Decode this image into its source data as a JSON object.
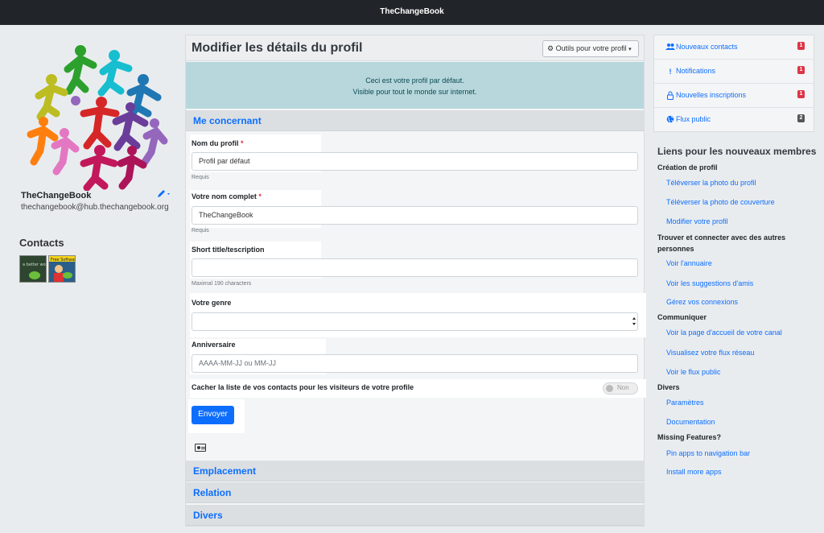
{
  "topbar": {
    "brand": "TheChangeBook"
  },
  "profile": {
    "name": "TheChangeBook",
    "address": "thechangebook@hub.thechangebook.org"
  },
  "contacts": {
    "title": "Contacts"
  },
  "panel": {
    "title": "Modifier les détails du profil",
    "tools_label": "Outils pour votre profil",
    "info_line1": "Ceci est votre profil par défaut.",
    "info_line2": "Visible pour tout le monde sur internet.",
    "section_about": "Me concernant",
    "fields": {
      "profile_name_label": "Nom du profil",
      "profile_name_value": "Profil par défaut",
      "profile_name_help": "Requis",
      "full_name_label": "Votre nom complet",
      "full_name_value": "TheChangeBook",
      "full_name_help": "Requis",
      "short_title_label": "Short title/tescription",
      "short_title_help": "Maximal 190 characters",
      "gender_label": "Votre genre",
      "birthday_label": "Anniversaire",
      "birthday_placeholder": "AAAA-MM-JJ ou MM-JJ",
      "hide_contacts_label": "Cacher la liste de vos contacts pour les visiteurs de votre profile",
      "hide_contacts_value": "Non",
      "required_mark": "*"
    },
    "submit_label": "Envoyer",
    "sections": [
      "Emplacement",
      "Relation",
      "Divers"
    ]
  },
  "notifications": [
    {
      "icon": "users-icon",
      "label": "Nouveaux contacts",
      "count": "1",
      "color": "#dc3545"
    },
    {
      "icon": "exclamation-icon",
      "label": "Notifications",
      "count": "1",
      "color": "#dc3545"
    },
    {
      "icon": "lock-icon",
      "label": "Nouvelles inscriptions",
      "count": "1",
      "color": "#dc3545"
    },
    {
      "icon": "globe-icon",
      "label": "Flux public",
      "count": "2",
      "color": "#555555"
    }
  ],
  "help": {
    "title": "Liens pour les nouveaux membres",
    "cat_profile": "Création de profil",
    "link_upload_photo": "Téléverser la photo du profil",
    "link_upload_cover": "Téléverser la photo de couverture",
    "link_edit_profile": "Modifier votre profil",
    "cat_find": "Trouver et connecter avec des autres",
    "cat_find2": "personnes",
    "link_directory": "Voir l'annuaire",
    "link_suggestions": "Voir les suggestions d'amis",
    "link_connections": "Gérez vos connexions",
    "cat_communicate": "Communiquer",
    "link_channel_home": "Voir la page d'accueil de votre canal",
    "link_network": "Visualisez votre flux réseau",
    "link_public": "Voir le flux public",
    "cat_misc": "Divers",
    "link_settings": "Paramètres",
    "link_docs": "Documentation",
    "cat_missing": "Missing Features?",
    "link_pin": "Pin apps to navigation bar",
    "link_install": "Install more apps"
  }
}
